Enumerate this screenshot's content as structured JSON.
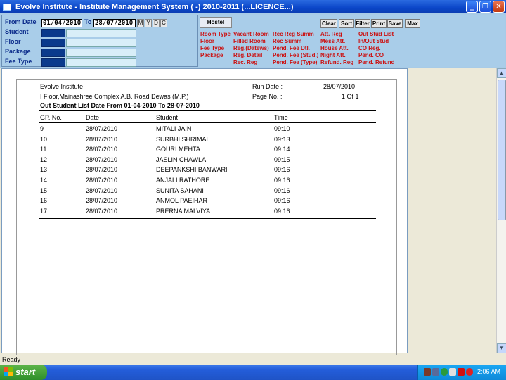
{
  "window": {
    "title": "Evolve Institute - Institute Management System ( -) 2010-2011 (...LICENCE...)",
    "minimize": "_",
    "restore": "❐",
    "close": "✕"
  },
  "filters": {
    "from_date_label": "From Date",
    "from_date": "01/04/2010",
    "to_label": "To",
    "to_date": "28/07/2010",
    "m": "M",
    "y": "Y",
    "d": "D",
    "c": "C",
    "student_label": "Student",
    "floor_label": "Floor",
    "package_label": "Package",
    "fee_type_label": "Fee Type"
  },
  "hostel": {
    "tab_label": "Hostel",
    "buttons": [
      "Clear",
      "Sort",
      "Filter",
      "Print",
      "Save",
      "Max"
    ],
    "col1": [
      "Room Type",
      "Floor",
      "Fee Type",
      "Package"
    ],
    "col2": [
      "Vacant Room",
      "Filled Room",
      "Reg.(Datews)",
      "Reg. Detail",
      "Rec. Reg"
    ],
    "col3": [
      "Rec Reg Summ",
      "Rec Summ",
      "Pend. Fee Dtl.",
      "Pend. Fee (Stud.)",
      "Pend. Fee (Type)"
    ],
    "col4": [
      "Att. Reg",
      "Mess Att.",
      "House Att.",
      "Night Att.",
      "Refund. Reg"
    ],
    "col5": [
      "Out Stud List",
      "In/Out Stud",
      "CO Reg.",
      "Pend. CO",
      "Pend. Refund"
    ]
  },
  "report": {
    "institute": "Evolve Institute",
    "address": "I Floor,Mainashree Complex A.B. Road Dewas (M.P.)",
    "heading": "Out Student List Date From 01-04-2010 To 28-07-2010",
    "run_date_label": "Run Date :",
    "run_date": "28/07/2010",
    "page_no_label": "Page No. :",
    "page_no": "1 Of 1",
    "columns": [
      "GP. No.",
      "Date",
      "Student",
      "Time"
    ],
    "rows": [
      [
        "9",
        "28/07/2010",
        "MITALI  JAIN",
        "09:10"
      ],
      [
        "10",
        "28/07/2010",
        "SURBHI  SHRIMAL",
        "09:13"
      ],
      [
        "11",
        "28/07/2010",
        "GOURI  MEHTA",
        "09:14"
      ],
      [
        "12",
        "28/07/2010",
        "JASLIN  CHAWLA",
        "09:15"
      ],
      [
        "13",
        "28/07/2010",
        "DEEPANKSHI  BANWARI",
        "09:16"
      ],
      [
        "14",
        "28/07/2010",
        "ANJALI  RATHORE",
        "09:16"
      ],
      [
        "15",
        "28/07/2010",
        "SUNITA  SAHANI",
        "09:16"
      ],
      [
        "16",
        "28/07/2010",
        "ANMOL  PAEIHAR",
        "09:16"
      ],
      [
        "17",
        "28/07/2010",
        "PRERNA  MALVIYA",
        "09:16"
      ]
    ]
  },
  "status": {
    "text": "Ready"
  },
  "taskbar": {
    "start_label": "start",
    "clock": "2:06 AM"
  },
  "colors": {
    "panel_bg": "#a9cde9",
    "link_red": "#cc1010",
    "label_blue": "#0a2a8a",
    "title_blue": "#0a45c8"
  }
}
